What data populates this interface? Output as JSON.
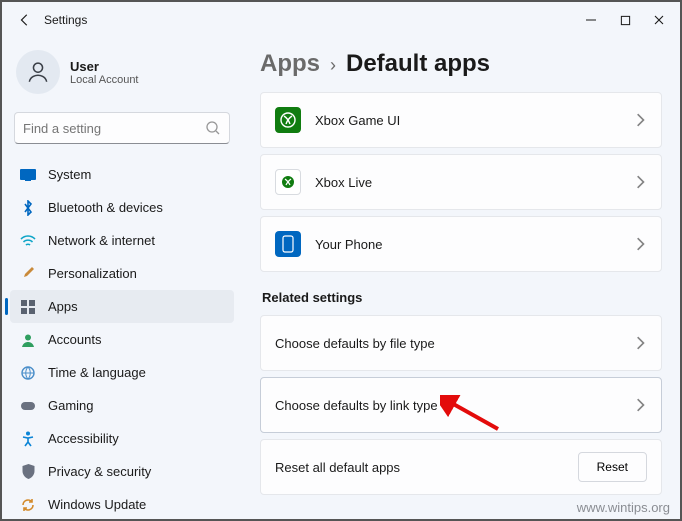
{
  "titlebar": {
    "title": "Settings"
  },
  "user": {
    "name": "User",
    "sub": "Local Account"
  },
  "search": {
    "placeholder": "Find a setting"
  },
  "nav": {
    "items": [
      {
        "label": "System"
      },
      {
        "label": "Bluetooth & devices"
      },
      {
        "label": "Network & internet"
      },
      {
        "label": "Personalization"
      },
      {
        "label": "Apps"
      },
      {
        "label": "Accounts"
      },
      {
        "label": "Time & language"
      },
      {
        "label": "Gaming"
      },
      {
        "label": "Accessibility"
      },
      {
        "label": "Privacy & security"
      },
      {
        "label": "Windows Update"
      }
    ]
  },
  "breadcrumb": {
    "parent": "Apps",
    "sep": "›",
    "current": "Default apps"
  },
  "apps": [
    {
      "label": "Xbox Game UI"
    },
    {
      "label": "Xbox Live"
    },
    {
      "label": "Your Phone"
    }
  ],
  "related": {
    "title": "Related settings",
    "items": [
      {
        "label": "Choose defaults by file type"
      },
      {
        "label": "Choose defaults by link type"
      }
    ],
    "reset": {
      "label": "Reset all default apps",
      "button": "Reset"
    }
  },
  "watermark": "www.wintips.org"
}
